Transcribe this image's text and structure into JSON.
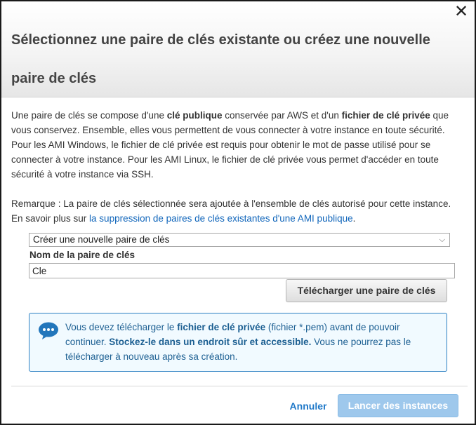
{
  "dialog": {
    "title": "Sélectionnez une paire de clés existante ou créez une nouvelle paire de clés",
    "close_symbol": "✕"
  },
  "intro": {
    "part1": "Une paire de clés se compose d'une ",
    "bold1": "clé publique",
    "part2": " conservée par AWS et d'un ",
    "bold2": "fichier de clé privée",
    "part3": " que vous conservez. Ensemble, elles vous permettent de vous connecter à votre instance en toute sécurité. Pour les AMI Windows, le fichier de clé privée est requis pour obtenir le mot de passe utilisé pour se connecter à votre instance. Pour les AMI Linux, le fichier de clé privée vous permet d'accéder en toute sécurité à votre instance via SSH."
  },
  "note": {
    "text": "Remarque : La paire de clés sélectionnée sera ajoutée à l'ensemble de clés autorisé pour cette instance. En savoir plus sur ",
    "link": "la suppression de paires de clés existantes d'une AMI publique",
    "end": "."
  },
  "keypair_select": {
    "selected": "Créer une nouvelle paire de clés",
    "chevron": "⌵"
  },
  "keypair_name": {
    "label": "Nom de la paire de clés",
    "value": "Cle"
  },
  "download_button": "Télécharger une paire de clés",
  "info": {
    "icon": "speech-bubble-icon",
    "part1": "Vous devez télécharger le ",
    "bold1": "fichier de clé privée",
    "part2": " (fichier *.pem) avant de pouvoir continuer. ",
    "bold2": "Stockez-le dans un endroit sûr et accessible.",
    "part3": " Vous ne pourrez pas le télécharger à nouveau après sa création."
  },
  "footer": {
    "cancel": "Annuler",
    "launch": "Lancer des instances"
  },
  "colors": {
    "link": "#1166bb",
    "info_border": "#2b7fc2",
    "info_background": "#f1faff",
    "launch_disabled": "#9ec8ec"
  }
}
